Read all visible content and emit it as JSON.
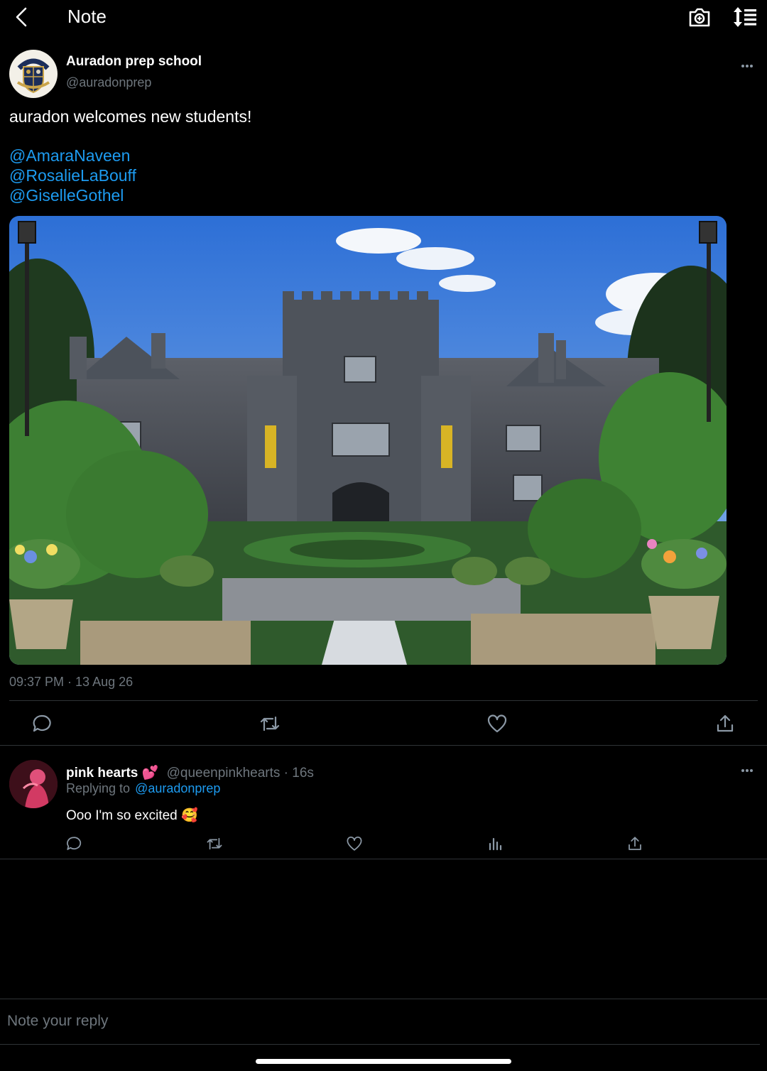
{
  "header": {
    "title": "Note",
    "back_icon": "chevron-left-icon",
    "camera_icon": "camera-icon",
    "sort_icon": "sort-list-icon"
  },
  "tweet": {
    "display_name": "Auradon prep school",
    "handle": "@auradonprep",
    "avatar_text": "AURADON",
    "avatar_sub": "PREP",
    "text": "auradon welcomes new students!",
    "mentions": [
      "@AmaraNaveen",
      "@RosalieLaBouff",
      "@GiselleGothel"
    ],
    "timestamp": "09:37 PM · 13 Aug 26",
    "more_icon": "more-icon"
  },
  "reply": {
    "display_name": "pink hearts 💕",
    "handle": "@queenpinkhearts",
    "time": "· 16s",
    "replying_prefix": "Replying to",
    "replying_handle": "@auradonprep",
    "text": "Ooo I'm so excited 🥰"
  },
  "composer": {
    "placeholder": "Note your reply"
  },
  "colors": {
    "background": "#000000",
    "link": "#1d9bf0",
    "muted": "#6e767d",
    "divider": "#2f3336"
  }
}
